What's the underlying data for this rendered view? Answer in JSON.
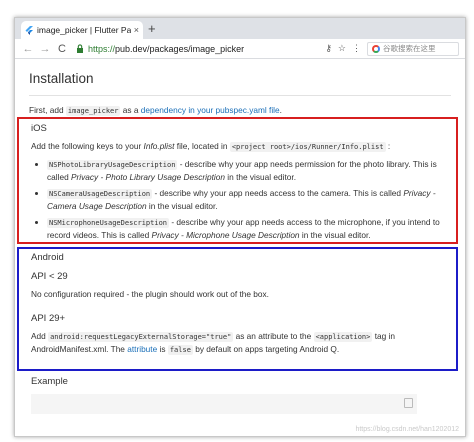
{
  "browser": {
    "tab_title": "image_picker | Flutter Package",
    "tab_close": "×",
    "new_tab": "+",
    "back": "←",
    "forward": "→",
    "reload": "C",
    "url_scheme": "https://",
    "url_rest": "pub.dev/packages/image_picker",
    "search_placeholder": "谷歌搜索在这里",
    "colors": {
      "tab_bar": "#dee1e6",
      "url_green": "#2e7d32"
    }
  },
  "page": {
    "title": "Installation",
    "intro": {
      "prefix": "First, add",
      "code": "image_picker",
      "middle": "as a",
      "link": "dependency in your pubspec.yaml file",
      "suffix": "."
    },
    "ios": {
      "heading": "iOS",
      "intro_prefix": "Add the following keys to your",
      "intro_em": "Info.plist",
      "intro_middle": "file, located in",
      "intro_code": "<project root>/ios/Runner/Info.plist",
      "intro_suffix": ":",
      "items": [
        {
          "code": "NSPhotoLibraryUsageDescription",
          "text": " - describe why your app needs permission for the photo library. This is called ",
          "em": "Privacy - Photo Library Usage Description",
          "suffix": " in the visual editor."
        },
        {
          "code": "NSCameraUsageDescription",
          "text": " - describe why your app needs access to the camera. This is called ",
          "em": "Privacy - Camera Usage Description",
          "suffix": " in the visual editor."
        },
        {
          "code": "NSMicrophoneUsageDescription",
          "text": " - describe why your app needs access to the microphone, if you intend to record videos. This is called ",
          "em": "Privacy - Microphone Usage Description",
          "suffix": " in the visual editor."
        }
      ]
    },
    "android": {
      "heading": "Android",
      "api_low": "API < 29",
      "api_low_text": "No configuration required - the plugin should work out of the box.",
      "api_high": "API 29+",
      "api_high_prefix": "Add",
      "api_high_code1": "android:requestLegacyExternalStorage=\"true\"",
      "api_high_middle": "as an attribute to the",
      "api_high_code2": "<application>",
      "api_high_middle2": "tag in AndroidManifest.xml. The",
      "api_high_link": "attribute",
      "api_high_middle3": "is",
      "api_high_code3": "false",
      "api_high_suffix": "by default on apps targeting Android Q."
    },
    "example_heading": "Example",
    "watermark": "https://blog.csdn.net/han1202012"
  }
}
